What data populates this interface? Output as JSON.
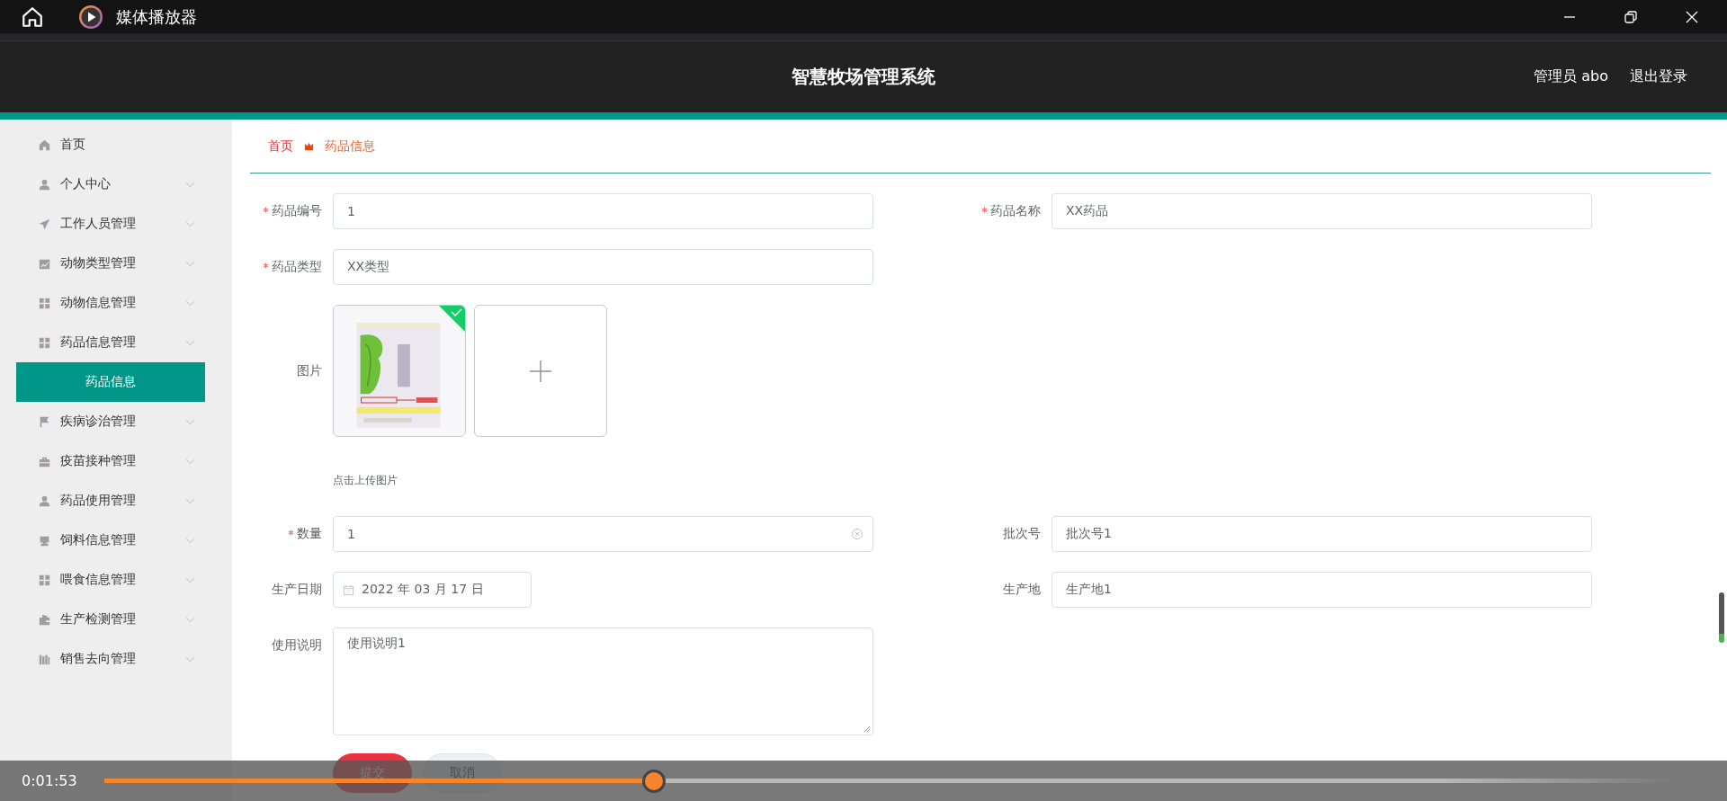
{
  "player": {
    "title": "媒体播放器",
    "time": "0:01:53",
    "level": 0.35
  },
  "header": {
    "title": "智慧牧场管理系统",
    "user": "管理员 abo",
    "logout": "退出登录"
  },
  "sidebar": {
    "items": [
      {
        "label": "首页",
        "kind": "link"
      },
      {
        "label": "个人中心",
        "kind": "submenu"
      },
      {
        "label": "工作人员管理",
        "kind": "submenu"
      },
      {
        "label": "动物类型管理",
        "kind": "submenu"
      },
      {
        "label": "动物信息管理",
        "kind": "submenu"
      },
      {
        "label": "药品信息管理",
        "kind": "submenu",
        "children": [
          {
            "label": "药品信息",
            "selected": true
          }
        ]
      },
      {
        "label": "疾病诊治管理",
        "kind": "submenu"
      },
      {
        "label": "疫苗接种管理",
        "kind": "submenu"
      },
      {
        "label": "药品使用管理",
        "kind": "submenu"
      },
      {
        "label": "饲料信息管理",
        "kind": "submenu"
      },
      {
        "label": "喂食信息管理",
        "kind": "submenu"
      },
      {
        "label": "生产检测管理",
        "kind": "submenu"
      },
      {
        "label": "销售去向管理",
        "kind": "submenu"
      }
    ]
  },
  "breadcrumb": [
    {
      "label": "首页"
    },
    {
      "label": "药品信息"
    }
  ],
  "form": {
    "rows": [
      [
        {
          "kind": "text",
          "label": "药品编号",
          "required": true,
          "value": "1"
        },
        {
          "kind": "text",
          "label": "药品名称",
          "required": true,
          "value": "XX药品"
        }
      ],
      [
        {
          "kind": "text",
          "label": "药品类型",
          "required": true,
          "value": "XX类型"
        }
      ],
      [
        {
          "kind": "upload",
          "label": "图片",
          "hint": "点击上传图片",
          "images": [
            {
              "kind": "picture",
              "uploaded": true
            }
          ]
        }
      ],
      [
        {
          "kind": "text",
          "label": "数量",
          "required": true,
          "value": "1",
          "clearable": true
        },
        {
          "kind": "text",
          "label": "批次号",
          "required": false,
          "value": "批次号1"
        }
      ],
      [
        {
          "kind": "date",
          "label": "生产日期",
          "required": false,
          "value": "2022 年 03 月 17 日"
        },
        {
          "kind": "text",
          "label": "生产地",
          "required": false,
          "value": "生产地1"
        }
      ],
      [
        {
          "kind": "textarea",
          "label": "使用说明",
          "required": false,
          "value": "使用说明1"
        }
      ]
    ],
    "buttons": [
      {
        "label": "提交",
        "kind": "primary"
      },
      {
        "label": "取消",
        "kind": "default"
      }
    ]
  }
}
